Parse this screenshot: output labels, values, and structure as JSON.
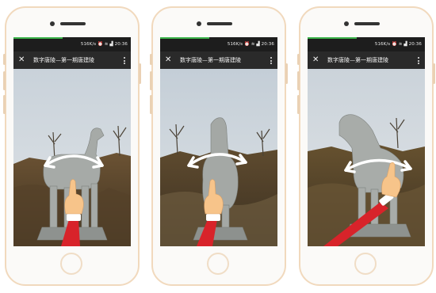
{
  "screens": [
    {
      "status": {
        "text": "516K/s ⏰ ≋ ▟ 20:36"
      },
      "title": "数字唐陵—第一期唐建陵",
      "close_icon": "close-icon",
      "menu_icon": "more-vertical-icon",
      "gesture": "rotate-left-right"
    },
    {
      "status": {
        "text": "516K/s ⏰ ≋ ▟ 20:36"
      },
      "title": "数字唐陵—第一期唐建陵",
      "close_icon": "close-icon",
      "menu_icon": "more-vertical-icon",
      "gesture": "rotate-left-right"
    },
    {
      "status": {
        "text": "516K/s ⏰ ≋ ▟ 20:36"
      },
      "title": "数字唐陵—第一期唐建陵",
      "close_icon": "close-icon",
      "menu_icon": "more-vertical-icon",
      "gesture": "rotate-left-right"
    }
  ],
  "colors": {
    "phone_frame": "#f1d9bd",
    "sleeve": "#d8232a",
    "hand": "#f7c48a",
    "sky": "#d6dde4",
    "statue": "#a8aca9",
    "arrow": "#ffffff"
  }
}
